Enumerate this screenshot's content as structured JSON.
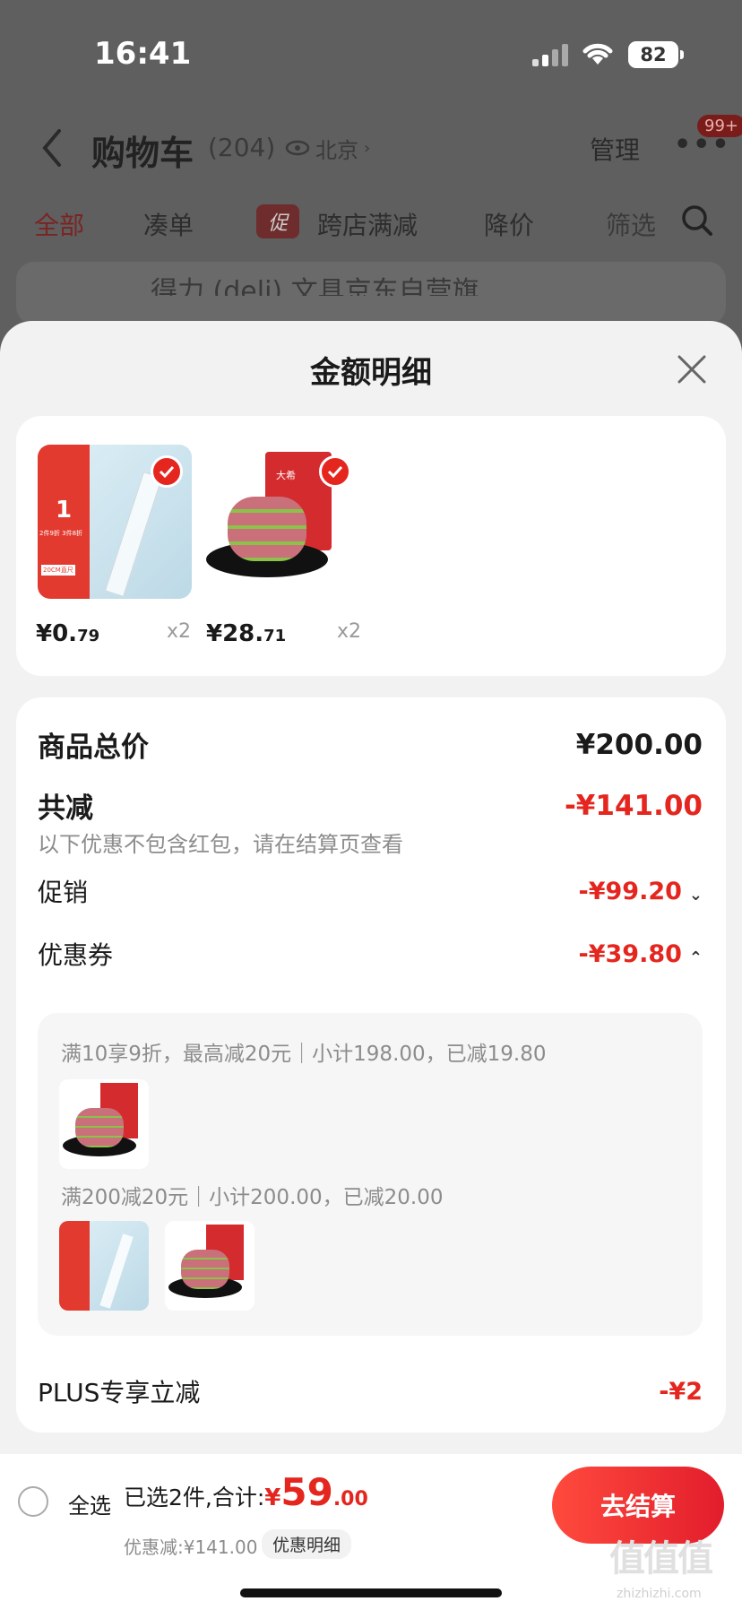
{
  "status": {
    "time": "16:41",
    "battery": "82"
  },
  "header": {
    "title": "购物车",
    "count": "(204)",
    "location": "北京",
    "manage": "管理",
    "badge": "99+"
  },
  "tabs": {
    "all": "全部",
    "combine": "凑单",
    "promo_tag": "促",
    "cross_store": "跨店满减",
    "price_drop": "降价",
    "filter": "筛选"
  },
  "store_strip": {
    "name": "得力 (deli) 文具京东自营旗"
  },
  "sheet": {
    "title": "金额明细",
    "products": [
      {
        "price_int": "¥0.",
        "price_dec": "79",
        "qty": "x2",
        "thumb_text": "1",
        "thumb_sub": "2件9折 3件8折",
        "thumb_tag": "20CM直尺"
      },
      {
        "price_int": "¥28.",
        "price_dec": "71",
        "qty": "x2",
        "thumb_text": "大希"
      }
    ],
    "total_label": "商品总价",
    "total_value": "¥200.00",
    "reduce_label": "共减",
    "reduce_value": "-¥141.00",
    "reduce_note": "以下优惠不包含红包，请在结算页查看",
    "promo_label": "促销",
    "promo_value": "-¥99.20",
    "coupon_label": "优惠券",
    "coupon_value": "-¥39.80",
    "coupon_rule1": "满10享9折，最高减20元｜小计198.00，已减19.80",
    "coupon_rule2": "满200减20元｜小计200.00，已减20.00",
    "plus_label": "PLUS专享立减",
    "plus_value": "-¥2"
  },
  "bottom": {
    "select_all": "全选",
    "selected": "已选2件,合计:",
    "currency": "¥",
    "amount_int": "59",
    "amount_dec": ".00",
    "discount": "优惠减:¥141.00",
    "detail": "优惠明细",
    "checkout": "去结算"
  },
  "watermark": {
    "brand": "值",
    "domain": "zhizhizhi.com"
  },
  "colors": {
    "accent": "#e4261f",
    "overlay": "#5f5f5f"
  }
}
